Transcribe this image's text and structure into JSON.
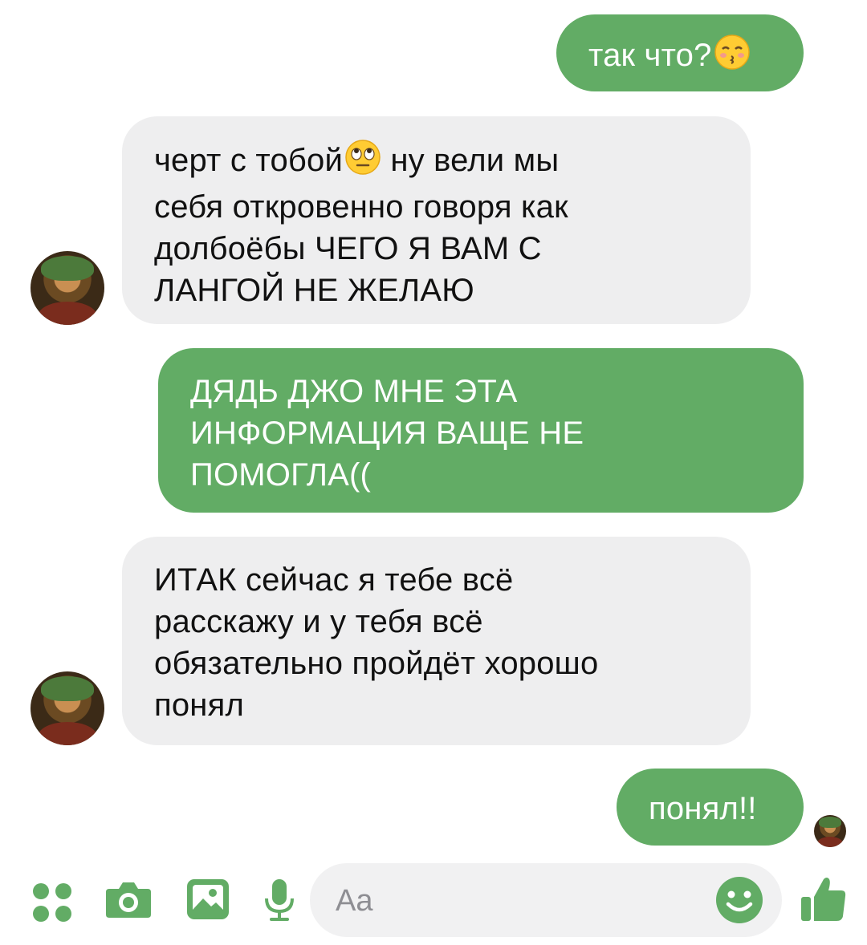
{
  "colors": {
    "outgoing_bubble": "#62ac65",
    "incoming_bubble": "#eeeeef",
    "accent": "#62ac65",
    "background": "#ffffff"
  },
  "messages": [
    {
      "direction": "outgoing",
      "text": "так что?",
      "emoji": "kissing-face-with-closed-eyes"
    },
    {
      "direction": "incoming",
      "text_before_emoji": "черт с тобой",
      "emoji": "face-with-rolling-eyes",
      "text_after_emoji": " ну вели мы\nсебя откровенно говоря как\nдолбоёбы ЧЕГО Я ВАМ С\nЛАНГОЙ НЕ ЖЕЛАЮ"
    },
    {
      "direction": "outgoing",
      "text": "ДЯДЬ ДЖО МНЕ ЭТА\nИНФОРМАЦИЯ ВАЩЕ НЕ\nПОМОГЛА(("
    },
    {
      "direction": "incoming",
      "text": "ИТАК сейчас я тебе всё\nрасскажу и у тебя всё\nобязательно пройдёт хорошо\nпонял"
    },
    {
      "direction": "outgoing",
      "text": "понял!!"
    }
  ],
  "composer": {
    "placeholder": "Aa",
    "icons": [
      "menu-dots-icon",
      "camera-icon",
      "gallery-icon",
      "microphone-icon",
      "emoji-icon",
      "thumbs-up-icon"
    ]
  }
}
